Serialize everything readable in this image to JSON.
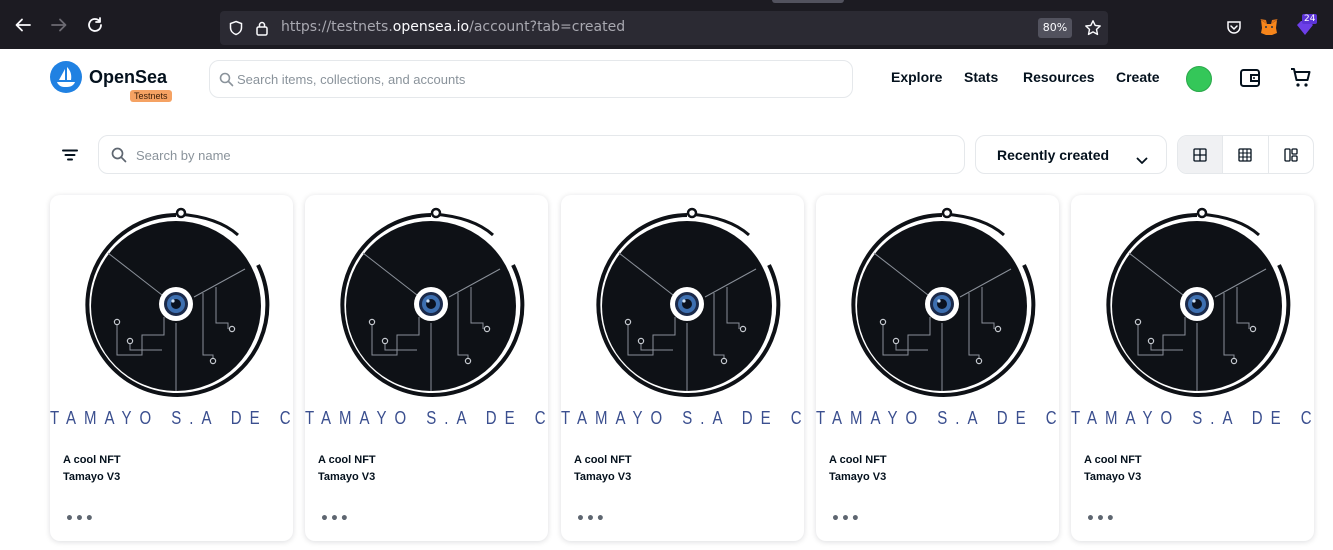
{
  "browser": {
    "url_prefix": "https://testnets.",
    "url_host": "opensea.io",
    "url_suffix": "/account?tab=created",
    "zoom": "80%",
    "extension_badge": "24"
  },
  "header": {
    "logo_text": "OpenSea",
    "badge": "Testnets",
    "search_placeholder": "Search items, collections, and accounts",
    "nav": [
      "Explore",
      "Stats",
      "Resources",
      "Create"
    ]
  },
  "toolbar": {
    "search_placeholder": "Search by name",
    "sort_label": "Recently created"
  },
  "cards": [
    {
      "brand": "TAMAYO S.A DE C.V",
      "collection": "A cool NFT",
      "name": "Tamayo V3",
      "more": "•••"
    },
    {
      "brand": "TAMAYO S.A DE C.V",
      "collection": "A cool NFT",
      "name": "Tamayo V3",
      "more": "•••"
    },
    {
      "brand": "TAMAYO S.A DE C.V",
      "collection": "A cool NFT",
      "name": "Tamayo V3",
      "more": "•••"
    },
    {
      "brand": "TAMAYO S.A DE C.V",
      "collection": "A cool NFT",
      "name": "Tamayo V3",
      "more": "•••"
    },
    {
      "brand": "TAMAYO S.A DE C.V",
      "collection": "A cool NFT",
      "name": "Tamayo V3",
      "more": "•••"
    }
  ],
  "colors": {
    "accent": "#2081e2",
    "badge": "#f5a263",
    "avatar": "#34c759",
    "art_dark": "#0e1116",
    "brand_text": "#3b4f8f"
  }
}
